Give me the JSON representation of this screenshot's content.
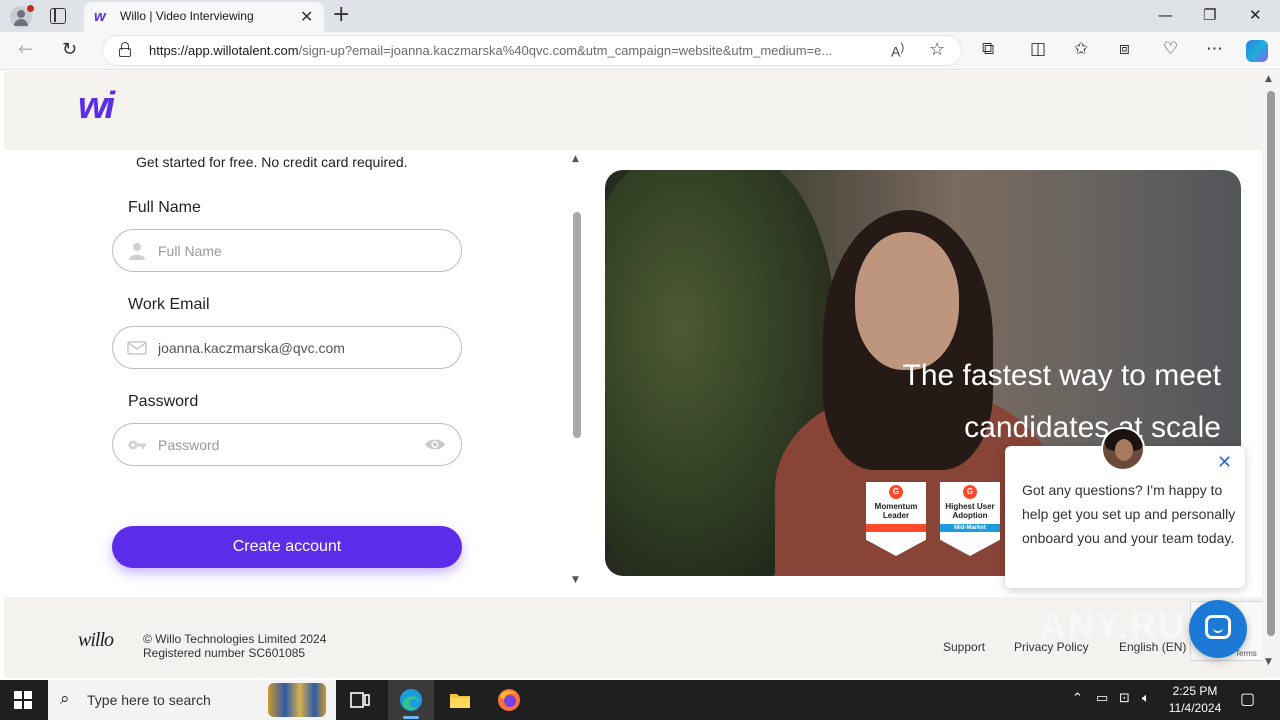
{
  "browser": {
    "tab_title": "Willo | Video Interviewing",
    "tab_favicon": "willo-logo-icon",
    "url_host": "https://app.willotalent.com",
    "url_path": "/sign-up?email=joanna.kaczmarska%40qvc.com&utm_campaign=website&utm_medium=e...",
    "window_controls": [
      "—",
      "❐",
      "✕"
    ]
  },
  "header": {
    "logo_text": "wi"
  },
  "form": {
    "subtitle": "Get started for free. No credit card required.",
    "full_name_label": "Full Name",
    "full_name_placeholder": "Full Name",
    "full_name_value": "",
    "email_label": "Work Email",
    "email_value": "joanna.kaczmarska@qvc.com",
    "password_label": "Password",
    "password_placeholder": "Password",
    "submit_label": "Create account"
  },
  "hero": {
    "tagline_line1": "The fastest way to meet",
    "tagline_line2": "candidates at scale",
    "badges": [
      {
        "text": "Momentum Leader",
        "stripe": "",
        "stripe_color": "#ff492c"
      },
      {
        "text": "Highest User Adoption",
        "stripe": "Mid-Market",
        "stripe_color": "#1f9be0"
      }
    ]
  },
  "chat": {
    "message": "Got any questions? I'm happy to help get you set up and personally onboard you and your team today."
  },
  "footer": {
    "logo_text": "willo",
    "copyright_line1": "© Willo Technologies Limited 2024",
    "copyright_line2": "Registered number SC601085",
    "links": [
      "Support",
      "Privacy Policy",
      "English (EN)"
    ],
    "recaptcha_terms": "Terms"
  },
  "watermark": "ANY.RUN",
  "taskbar": {
    "search_placeholder": "Type here to search",
    "time": "2:25 PM",
    "date": "11/4/2024"
  },
  "colors": {
    "brand": "#5b2de8",
    "page_bg": "#f4f2ef",
    "chat_blue": "#1c7ad6"
  }
}
